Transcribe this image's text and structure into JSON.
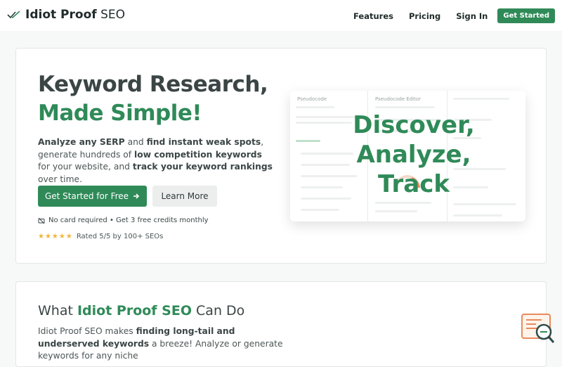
{
  "nav": {
    "brand_bold": "Idiot Proof",
    "brand_rest": "SEO",
    "links": [
      "Features",
      "Pricing",
      "Sign In"
    ],
    "cta": "Get Started"
  },
  "hero": {
    "title_line1": "Keyword Research,",
    "title_line2": "Made Simple!",
    "desc": {
      "p1": "Analyze any SERP",
      "p2": " and ",
      "p3": "find instant weak spots",
      "p4": ", generate hundreds of ",
      "p5": "low competition keywords",
      "p6": " for your website, and ",
      "p7": "track your keyword rankings",
      "p8": " over time."
    },
    "primary_button": "Get Started for Free",
    "secondary_button": "Learn More",
    "note": "No card required • Get 3 free credits monthly",
    "stars": "★★★★★",
    "rating": "Rated 5/5 by 100+ SEOs"
  },
  "preview": {
    "col1_title": "Pseudocode",
    "col2_title": "Pseudocode Editor",
    "overlay": [
      "Discover,",
      "Analyze,",
      "Track"
    ]
  },
  "section2": {
    "title_pre": "What ",
    "title_brand": "Idiot Proof SEO",
    "title_post": " Can Do",
    "desc": {
      "p1": "Idiot Proof SEO makes ",
      "p2": "finding long-tail and underserved keywords",
      "p3": " a breeze! Analyze or generate keywords for any niche"
    }
  },
  "colors": {
    "brand_green": "#2f8a58",
    "text_dark": "#3b4545",
    "star": "#f0b63a"
  }
}
